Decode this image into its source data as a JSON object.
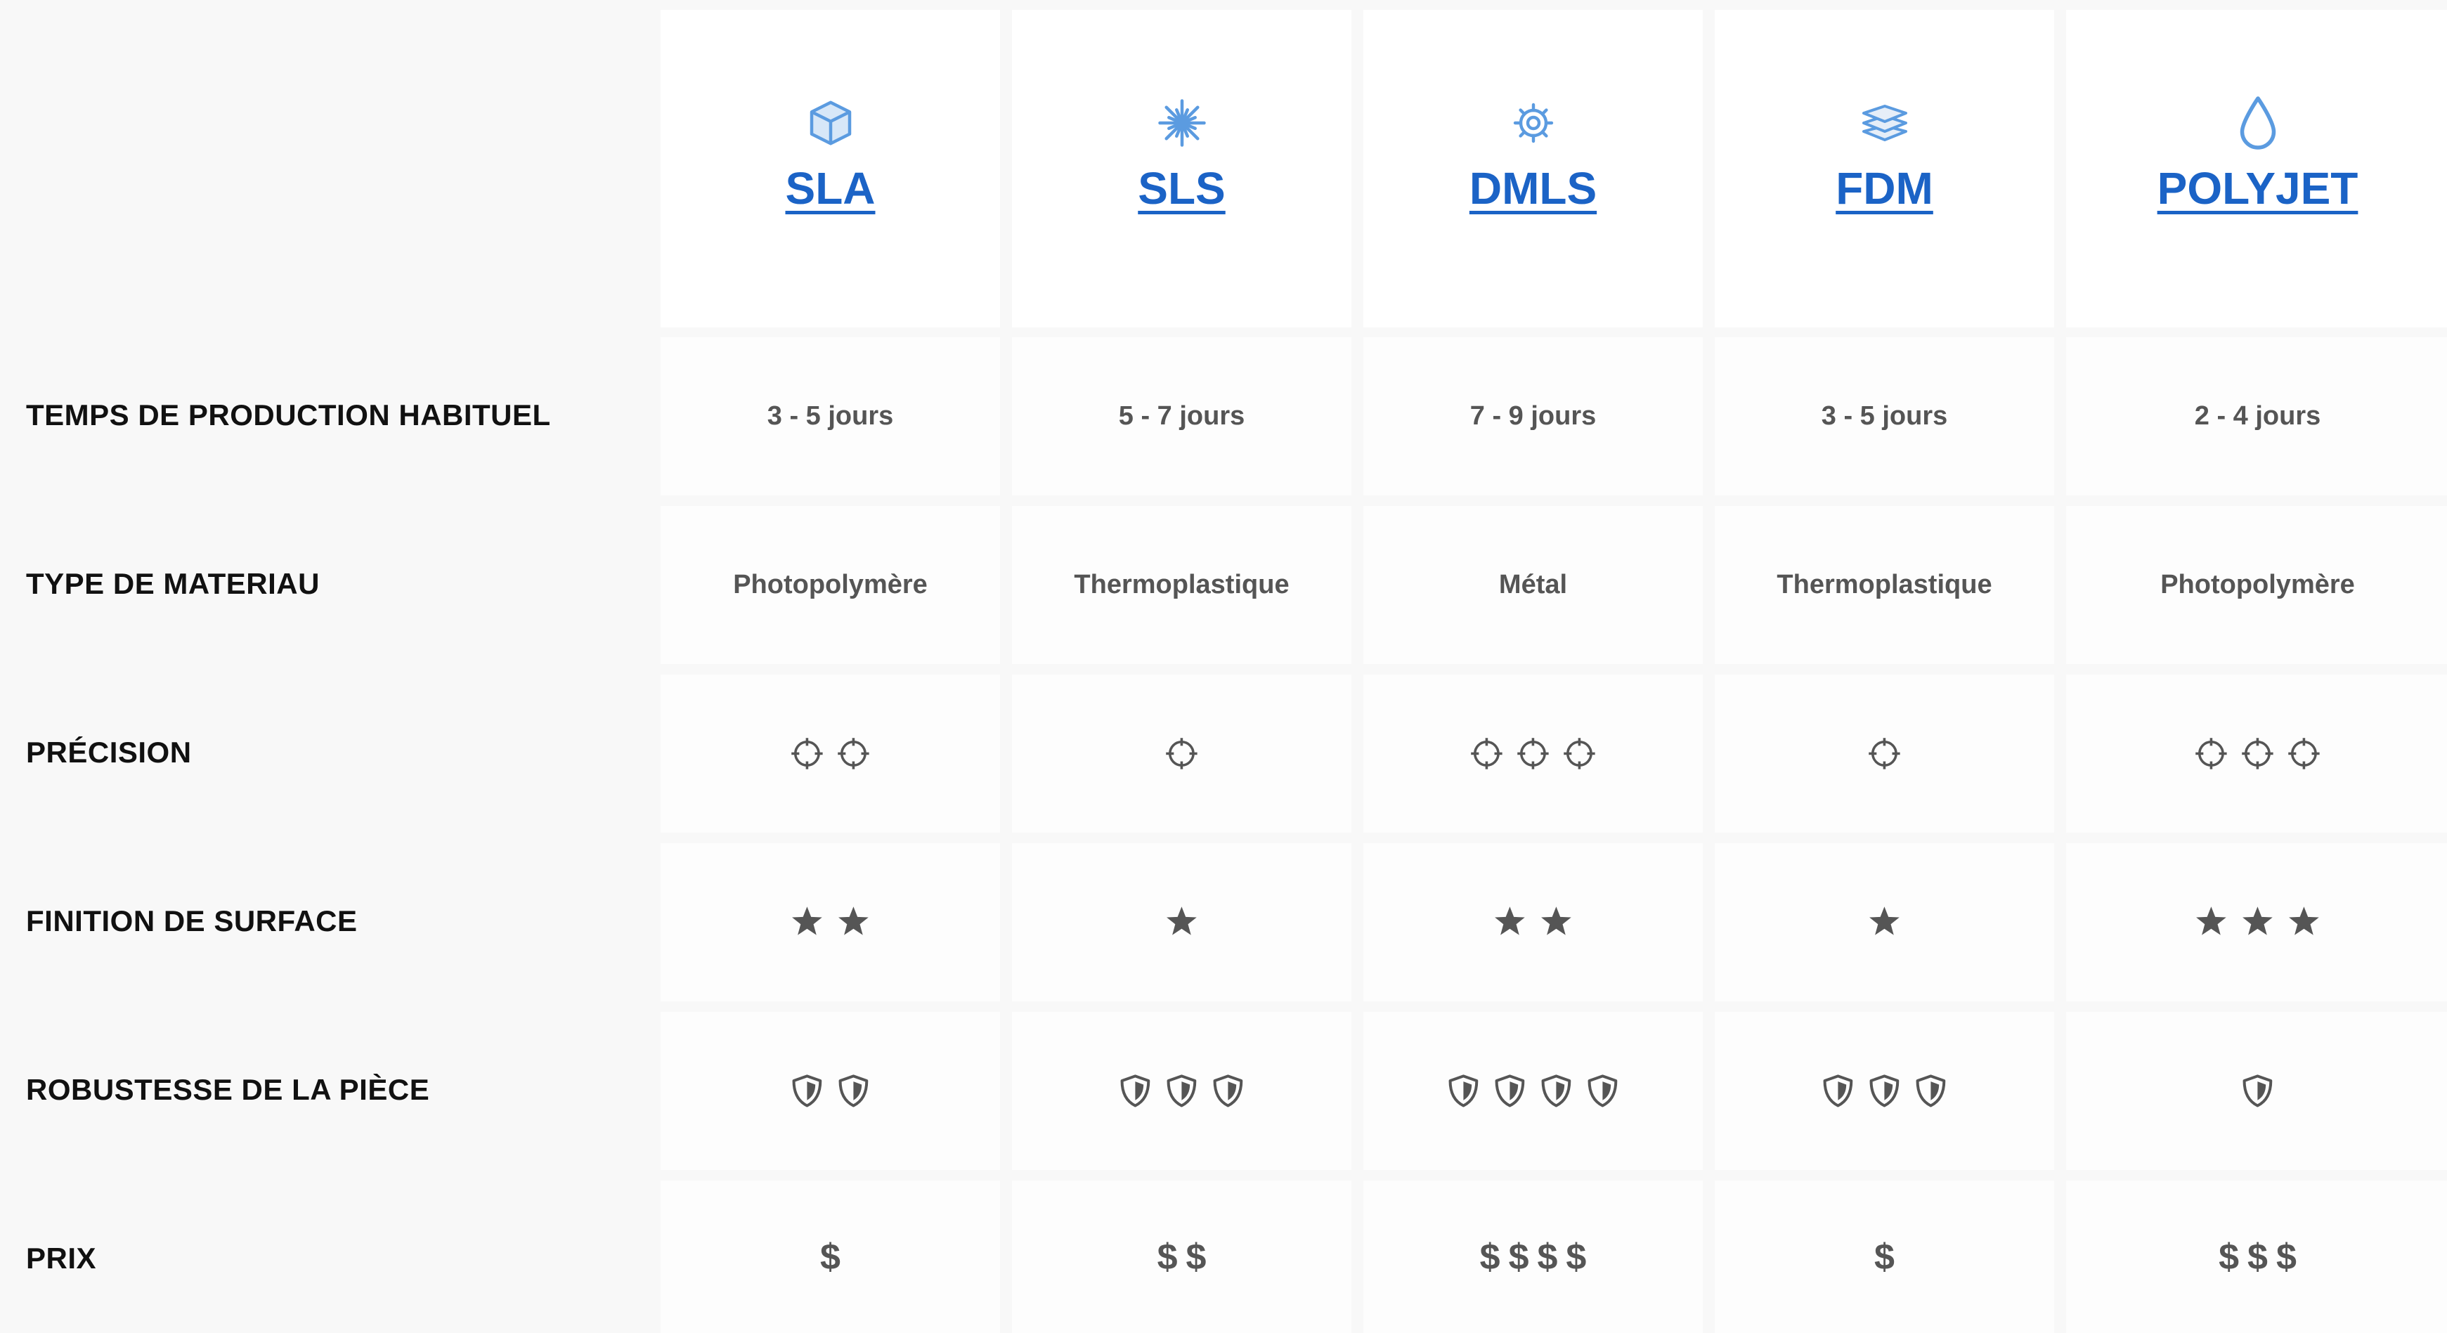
{
  "rows": [
    {
      "key": "production_time",
      "label": "TEMPS DE PRODUCTION HABITUEL"
    },
    {
      "key": "material_type",
      "label": "TYPE DE MATERIAU"
    },
    {
      "key": "precision",
      "label": "PRÉCISION"
    },
    {
      "key": "surface_finish",
      "label": "FINITION DE SURFACE"
    },
    {
      "key": "strength",
      "label": "ROBUSTESSE DE LA PIÈCE"
    },
    {
      "key": "price",
      "label": "PRIX"
    }
  ],
  "technologies": [
    {
      "name": "SLA",
      "icon": "cube-icon",
      "production_time": "3 - 5 jours",
      "material_type": "Photopolymère",
      "precision": 2,
      "surface_finish": 2,
      "strength": 2,
      "price": "$"
    },
    {
      "name": "SLS",
      "icon": "laser-burst-icon",
      "production_time": "5 - 7 jours",
      "material_type": "Thermoplastique",
      "precision": 1,
      "surface_finish": 1,
      "strength": 3,
      "price": "$$"
    },
    {
      "name": "DMLS",
      "icon": "gear-icon",
      "production_time": "7 - 9 jours",
      "material_type": "Métal",
      "precision": 3,
      "surface_finish": 2,
      "strength": 4,
      "price": "$$$$"
    },
    {
      "name": "FDM",
      "icon": "layers-icon",
      "production_time": "3 - 5 jours",
      "material_type": "Thermoplastique",
      "precision": 1,
      "surface_finish": 1,
      "strength": 3,
      "price": "$"
    },
    {
      "name": "POLYJET",
      "icon": "droplet-icon",
      "production_time": "2 - 4 jours",
      "material_type": "Photopolymère",
      "precision": 3,
      "surface_finish": 3,
      "strength": 1,
      "price": "$$$"
    }
  ],
  "colors": {
    "link": "#1b63c6",
    "icon_blue": "#5b9be0",
    "text_gray": "#555555",
    "label": "#111111"
  }
}
